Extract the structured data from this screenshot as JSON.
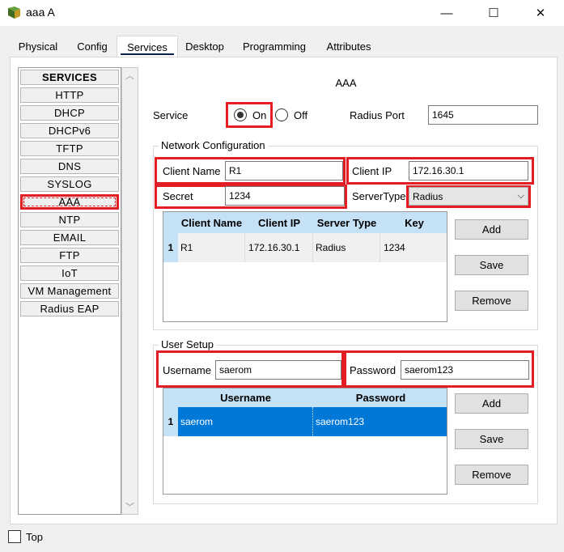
{
  "window": {
    "title": "aaa A",
    "minimize": "—",
    "maximize": "☐",
    "close": "✕"
  },
  "tabs": [
    "Physical",
    "Config",
    "Services",
    "Desktop",
    "Programming",
    "Attributes"
  ],
  "active_tab": "Services",
  "services": {
    "header": "SERVICES",
    "items": [
      "HTTP",
      "DHCP",
      "DHCPv6",
      "TFTP",
      "DNS",
      "SYSLOG",
      "AAA",
      "NTP",
      "EMAIL",
      "FTP",
      "IoT",
      "VM Management",
      "Radius EAP"
    ],
    "selected": "AAA"
  },
  "aaa": {
    "title": "AAA",
    "service_label": "Service",
    "on_label": "On",
    "off_label": "Off",
    "service_state": "On",
    "radius_port_label": "Radius Port",
    "radius_port_value": "1645"
  },
  "network_config": {
    "title": "Network Configuration",
    "client_name_label": "Client Name",
    "client_name_value": "R1",
    "client_ip_label": "Client IP",
    "client_ip_value": "172.16.30.1",
    "secret_label": "Secret",
    "secret_value": "1234",
    "server_type_label": "ServerType",
    "server_type_value": "Radius",
    "table": {
      "headers": [
        "Client Name",
        "Client IP",
        "Server Type",
        "Key"
      ],
      "rows": [
        {
          "num": "1",
          "client_name": "R1",
          "client_ip": "172.16.30.1",
          "server_type": "Radius",
          "key": "1234"
        }
      ]
    },
    "buttons": {
      "add": "Add",
      "save": "Save",
      "remove": "Remove"
    }
  },
  "user_setup": {
    "title": "User Setup",
    "username_label": "Username",
    "username_value": "saerom",
    "password_label": "Password",
    "password_value": "saerom123",
    "table": {
      "headers": [
        "Username",
        "Password"
      ],
      "rows": [
        {
          "num": "1",
          "username": "saerom",
          "password": "saerom123"
        }
      ]
    },
    "buttons": {
      "add": "Add",
      "save": "Save",
      "remove": "Remove"
    }
  },
  "footer": {
    "top_label": "Top"
  },
  "colors": {
    "highlight_red": "#e21d24",
    "table_header_blue": "#c4e1f6",
    "selected_row_blue": "#0078d7"
  }
}
